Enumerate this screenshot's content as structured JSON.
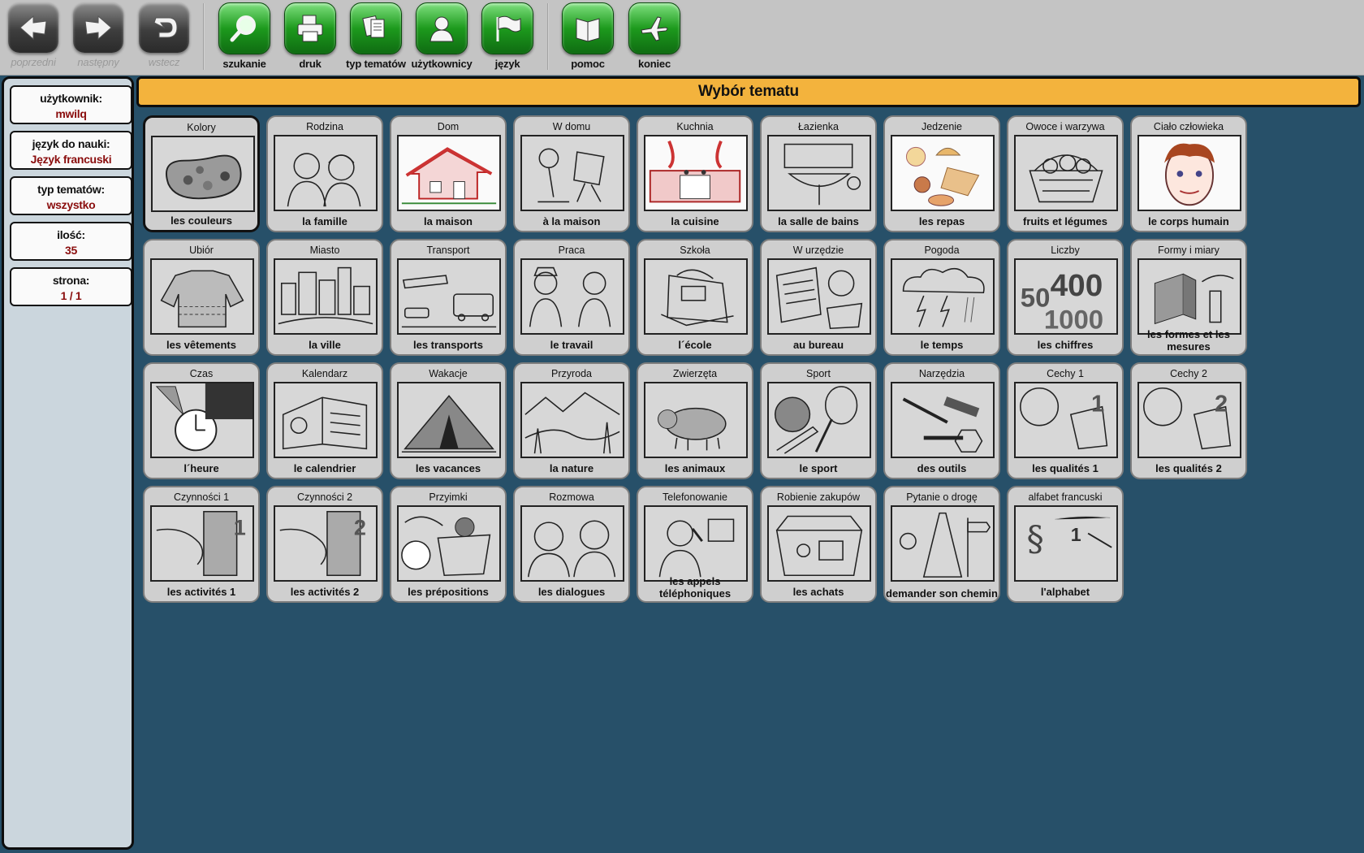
{
  "toolbar": {
    "buttons": [
      {
        "label": "poprzedni",
        "icon": "arrow-left-icon",
        "enabled": false
      },
      {
        "label": "następny",
        "icon": "arrow-right-icon",
        "enabled": false
      },
      {
        "label": "wstecz",
        "icon": "undo-icon",
        "enabled": false
      },
      {
        "label": "szukanie",
        "icon": "magnifier-icon",
        "enabled": true
      },
      {
        "label": "druk",
        "icon": "printer-icon",
        "enabled": true
      },
      {
        "label": "typ tematów",
        "icon": "cards-icon",
        "enabled": true
      },
      {
        "label": "użytkownicy",
        "icon": "user-icon",
        "enabled": true
      },
      {
        "label": "język",
        "icon": "flag-icon",
        "enabled": true
      },
      {
        "label": "pomoc",
        "icon": "book-icon",
        "enabled": true
      },
      {
        "label": "koniec",
        "icon": "airplane-icon",
        "enabled": true
      }
    ]
  },
  "sidebar": {
    "user_label": "użytkownik:",
    "user_value": "mwilq",
    "language_label": "język do nauki:",
    "language_value": "Język francuski",
    "topic_type_label": "typ tematów:",
    "topic_type_value": "wszystko",
    "count_label": "ilość:",
    "count_value": "35",
    "page_label": "strona:",
    "page_value": "1 / 1"
  },
  "main": {
    "title": "Wybór tematu",
    "topics": [
      {
        "pl": "Kolory",
        "fr": "les couleurs",
        "selected": true,
        "pic": "palette"
      },
      {
        "pl": "Rodzina",
        "fr": "la famille",
        "pic": "family"
      },
      {
        "pl": "Dom",
        "fr": "la maison",
        "pic": "house",
        "color": true
      },
      {
        "pl": "W domu",
        "fr": "à la maison",
        "pic": "lamp"
      },
      {
        "pl": "Kuchnia",
        "fr": "la cuisine",
        "pic": "kitchen",
        "color": true
      },
      {
        "pl": "Łazienka",
        "fr": "la salle de bains",
        "pic": "sink"
      },
      {
        "pl": "Jedzenie",
        "fr": "les repas",
        "pic": "food",
        "color": true
      },
      {
        "pl": "Owoce i warzywa",
        "fr": "fruits et légumes",
        "pic": "basket"
      },
      {
        "pl": "Ciało człowieka",
        "fr": "le corps humain",
        "pic": "face",
        "color": true
      },
      {
        "pl": "Ubiór",
        "fr": "les vêtements",
        "pic": "sweater"
      },
      {
        "pl": "Miasto",
        "fr": "la ville",
        "pic": "city"
      },
      {
        "pl": "Transport",
        "fr": "les transports",
        "pic": "bus"
      },
      {
        "pl": "Praca",
        "fr": "le travail",
        "pic": "workers"
      },
      {
        "pl": "Szkoła",
        "fr": "l´école",
        "pic": "schoolbag"
      },
      {
        "pl": "W urzędzie",
        "fr": "au bureau",
        "pic": "papers"
      },
      {
        "pl": "Pogoda",
        "fr": "le temps",
        "pic": "storm"
      },
      {
        "pl": "Liczby",
        "fr": "les chiffres",
        "pic": "numbers"
      },
      {
        "pl": "Formy i miary",
        "fr": "les formes et les mesures",
        "pic": "shapes"
      },
      {
        "pl": "Czas",
        "fr": "l´heure",
        "pic": "clock"
      },
      {
        "pl": "Kalendarz",
        "fr": "le calendrier",
        "pic": "calendar"
      },
      {
        "pl": "Wakacje",
        "fr": "les vacances",
        "pic": "tent"
      },
      {
        "pl": "Przyroda",
        "fr": "la nature",
        "pic": "landscape"
      },
      {
        "pl": "Zwierzęta",
        "fr": "les animaux",
        "pic": "pig"
      },
      {
        "pl": "Sport",
        "fr": "le sport",
        "pic": "sport"
      },
      {
        "pl": "Narzędzia",
        "fr": "des outils",
        "pic": "tools"
      },
      {
        "pl": "Cechy 1",
        "fr": "les qualités 1",
        "pic": "traits1"
      },
      {
        "pl": "Cechy 2",
        "fr": "les qualités 2",
        "pic": "traits2"
      },
      {
        "pl": "Czynności 1",
        "fr": "les activités 1",
        "pic": "door1"
      },
      {
        "pl": "Czynności 2",
        "fr": "les activités 2",
        "pic": "door2"
      },
      {
        "pl": "Przyimki",
        "fr": "les prépositions",
        "pic": "cat"
      },
      {
        "pl": "Rozmowa",
        "fr": "les dialogues",
        "pic": "dialog"
      },
      {
        "pl": "Telefonowanie",
        "fr": "les appels téléphoniques",
        "pic": "phone"
      },
      {
        "pl": "Robienie zakupów",
        "fr": "les achats",
        "pic": "shop"
      },
      {
        "pl": "Pytanie o drogę",
        "fr": "demander son chemin",
        "pic": "road"
      },
      {
        "pl": "alfabet francuski",
        "fr": "l'alphabet",
        "pic": "alphabet"
      }
    ]
  }
}
